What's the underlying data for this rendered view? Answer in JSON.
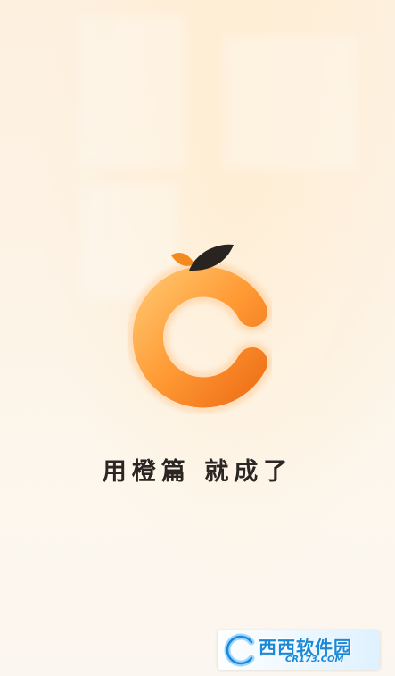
{
  "splash": {
    "slogan": "用橙篇 就成了",
    "logo_icon": "orange-c-logo-icon",
    "colors": {
      "orange_light": "#ffb65a",
      "orange_dark": "#f2781c",
      "leaf_dark": "#2a2420",
      "leaf_orange": "#f28a1e",
      "text": "#2b2623"
    }
  },
  "watermark": {
    "name": "西西软件园",
    "domain": "CR173.COM"
  }
}
